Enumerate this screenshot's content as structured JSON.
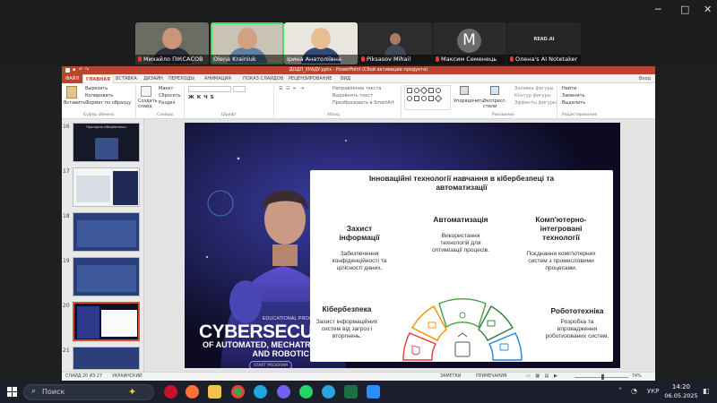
{
  "meeting": {
    "controls": {
      "minimize": "─",
      "maximize": "□",
      "close": "✕"
    },
    "participants": [
      {
        "name": "Михайло ПІКСАСОВ",
        "muted": true,
        "kind": "video"
      },
      {
        "name": "Olena Krainiuk",
        "muted": false,
        "kind": "video",
        "active": true
      },
      {
        "name": "Ірина Анатоліївна",
        "muted": false,
        "kind": "video"
      },
      {
        "name": "Piksasov Mihail",
        "muted": true,
        "kind": "video"
      },
      {
        "name": "Максим Семенець",
        "muted": true,
        "kind": "initial",
        "initial": "M"
      },
      {
        "name": "Олена's AI Notetaker",
        "muted": true,
        "kind": "logo",
        "logo_text": "READ.AI"
      }
    ]
  },
  "ppt": {
    "title": "ДОДП_УРАДУ.pptx - PowerPoint (Сбой активации продукта)",
    "sign_in": "Вход",
    "tabs": [
      "ФАЙЛ",
      "ГЛАВНАЯ",
      "ВСТАВКА",
      "ДИЗАЙН",
      "ПЕРЕХОДЫ",
      "АНИМАЦИЯ",
      "ПОКАЗ СЛАЙДОВ",
      "РЕЦЕНЗИРОВАНИЕ",
      "ВИД"
    ],
    "ribbon": {
      "paste": "Вставить",
      "cut": "Вырезать",
      "copy": "Копировать",
      "format_painter": "Формат по образцу",
      "clipboard": "Буфер обмена",
      "new_slide": "Создать слайд",
      "layout": "Макет",
      "reset": "Сбросить",
      "section": "Раздел",
      "slides": "Слайды",
      "font": "Шрифт",
      "text_direction": "Направление текста",
      "align_text": "Выровнять текст",
      "smartart": "Преобразовать в SmartArt",
      "paragraph": "Абзац",
      "arrange": "Упорядочить",
      "quick_styles": "Экспресс-стили",
      "drawing": "Рисование",
      "shape_fill": "Заливка фигуры",
      "shape_outline": "Контур фигуры",
      "shape_effects": "Эффекты фигуры",
      "find": "Найти",
      "replace": "Заменить",
      "select": "Выделить",
      "editing": "Редактирование"
    },
    "thumbnails": [
      {
        "num": "16",
        "title": "Принципи кібербезпеки"
      },
      {
        "num": "17",
        "title": ""
      },
      {
        "num": "18",
        "title": ""
      },
      {
        "num": "19",
        "title": ""
      },
      {
        "num": "20",
        "title": "",
        "selected": true
      },
      {
        "num": "21",
        "title": ""
      }
    ],
    "slide": {
      "program": "EDUCATIONAL PROGRAM",
      "big_title": "CYBERSECURI",
      "line2": "OF AUTOMATED, MECHATRO",
      "line3": "AND ROBOTIC SYSTEMS",
      "button": "START PROGRAM",
      "card_title": "Інноваційні технології навчання в кібербезпеці та автоматизації",
      "items": [
        {
          "title": "Захист інформації",
          "text": "Забезпечення конфіденційності та цілісності даних."
        },
        {
          "title": "Автоматизація",
          "text": "Використання технологій для оптимізації процесів."
        },
        {
          "title": "Комп'ютерно-інтегровані технології",
          "text": "Поєднання комп'ютерних систем з промисловими процесами."
        },
        {
          "title": "Кібербезпека",
          "text": "Захист інформаційних систем від загроз і вторгнень."
        },
        {
          "title": "Робототехніка",
          "text": "Розробка та впровадження роботизованих систем."
        }
      ]
    },
    "status": {
      "slide_of": "СЛАЙД 20 ИЗ 27",
      "lang": "УКРАИНСКИЙ",
      "notes": "ЗАМЕТКИ",
      "comments": "ПРИМЕЧАНИЯ",
      "zoom": "74%"
    }
  },
  "taskbar": {
    "search": "Поиск",
    "lang": "УКР",
    "time": "14:20",
    "date": "06.05.2025",
    "apps": [
      "widgets",
      "opera",
      "firefox",
      "file-explorer",
      "chrome",
      "microsoft-edge",
      "viber",
      "whatsapp",
      "telegram",
      "excel",
      "zoom"
    ]
  },
  "colors": {
    "ppt_accent": "#b7472a",
    "active_speaker": "#4cd964",
    "taskbar": "#1b1f2b"
  }
}
